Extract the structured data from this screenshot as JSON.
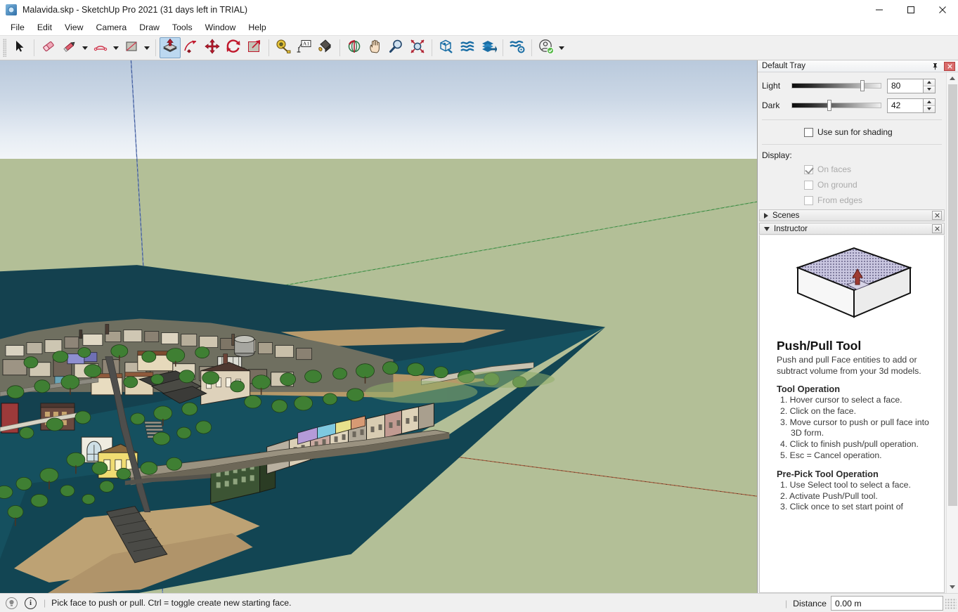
{
  "window": {
    "title": "Malavida.skp - SketchUp Pro 2021 (31 days left in TRIAL)",
    "app_icon": "sketchup-logo-icon",
    "minimize": "–",
    "maximize": "☐",
    "close": "✕"
  },
  "menu": {
    "items": [
      {
        "label": "File"
      },
      {
        "label": "Edit"
      },
      {
        "label": "View"
      },
      {
        "label": "Camera"
      },
      {
        "label": "Draw"
      },
      {
        "label": "Tools"
      },
      {
        "label": "Window"
      },
      {
        "label": "Help"
      }
    ]
  },
  "toolbar": {
    "groups": [
      {
        "tools": [
          {
            "name": "select-tool",
            "icon": "cursor-arrow-icon",
            "active": false,
            "dropdown": false
          }
        ]
      },
      {
        "tools": [
          {
            "name": "eraser-tool",
            "icon": "eraser-icon",
            "active": false,
            "dropdown": false
          },
          {
            "name": "line-tool",
            "icon": "pencil-icon",
            "active": false,
            "dropdown": true
          },
          {
            "name": "arc-tool",
            "icon": "arc-icon",
            "active": false,
            "dropdown": true
          },
          {
            "name": "rectangle-tool",
            "icon": "rectangle-icon",
            "active": false,
            "dropdown": true
          }
        ]
      },
      {
        "tools": [
          {
            "name": "push-pull-tool",
            "icon": "push-pull-icon",
            "active": true,
            "dropdown": false
          },
          {
            "name": "follow-me-tool",
            "icon": "follow-me-icon",
            "active": false,
            "dropdown": false
          },
          {
            "name": "move-tool",
            "icon": "move-arrows-icon",
            "active": false,
            "dropdown": false
          },
          {
            "name": "rotate-tool",
            "icon": "rotate-arrows-icon",
            "active": false,
            "dropdown": false
          },
          {
            "name": "scale-tool",
            "icon": "scale-icon",
            "active": false,
            "dropdown": false
          }
        ]
      },
      {
        "tools": [
          {
            "name": "tape-measure-tool",
            "icon": "tape-measure-icon",
            "active": false,
            "dropdown": false
          },
          {
            "name": "text-tool",
            "icon": "text-a1-icon",
            "active": false,
            "dropdown": false
          },
          {
            "name": "paint-bucket-tool",
            "icon": "paint-bucket-icon",
            "active": false,
            "dropdown": false
          }
        ]
      },
      {
        "tools": [
          {
            "name": "orbit-tool",
            "icon": "orbit-icon",
            "active": false,
            "dropdown": false
          },
          {
            "name": "pan-tool",
            "icon": "hand-pan-icon",
            "active": false,
            "dropdown": false
          },
          {
            "name": "zoom-tool",
            "icon": "magnifier-icon",
            "active": false,
            "dropdown": false
          },
          {
            "name": "zoom-extents-tool",
            "icon": "zoom-extents-icon",
            "active": false,
            "dropdown": false
          }
        ]
      },
      {
        "tools": [
          {
            "name": "3d-warehouse-tool",
            "icon": "warehouse-box-icon",
            "active": false,
            "dropdown": false
          },
          {
            "name": "extension-warehouse-tool",
            "icon": "extension-warehouse-icon",
            "active": false,
            "dropdown": false
          },
          {
            "name": "share-model-tool",
            "icon": "share-layers-icon",
            "active": false,
            "dropdown": false
          }
        ]
      },
      {
        "tools": [
          {
            "name": "extension-manager-tool",
            "icon": "extension-gear-icon",
            "active": false,
            "dropdown": false
          }
        ]
      },
      {
        "tools": [
          {
            "name": "account-tool",
            "icon": "user-account-icon",
            "active": false,
            "dropdown": true
          }
        ]
      }
    ]
  },
  "viewport": {
    "name": "3d-model-viewport",
    "model_description": "Aerial 3D city model of a riverside town with buildings, trees and a bridge",
    "colors": {
      "sky_top": "#b9c9dc",
      "sky_bottom": "#f2f5f8",
      "ground": "#b3bf97",
      "water": "#14414f",
      "sand": "#b99c6e",
      "axis_blue": "#3d5a9e",
      "axis_green": "#3a8a3f",
      "axis_red": "#a85a3a"
    }
  },
  "tray": {
    "title": "Default Tray",
    "pin_icon": "pin-icon",
    "close_icon": "close-icon",
    "shadow_settings": {
      "light": {
        "label": "Light",
        "value": "80",
        "slider_percent": 80
      },
      "dark": {
        "label": "Dark",
        "value": "42",
        "slider_percent": 42
      },
      "use_sun": {
        "label": "Use sun for shading",
        "checked": false
      },
      "display_label": "Display:",
      "display_options": [
        {
          "label": "On faces",
          "checked": true,
          "disabled": true
        },
        {
          "label": "On ground",
          "checked": false,
          "disabled": true
        },
        {
          "label": "From edges",
          "checked": false,
          "disabled": true
        }
      ]
    },
    "panels": [
      {
        "name": "scenes",
        "label": "Scenes",
        "expanded": false,
        "close_label": "✕"
      },
      {
        "name": "instructor",
        "label": "Instructor",
        "expanded": true,
        "close_label": "✕"
      }
    ]
  },
  "instructor": {
    "image_name": "push-pull-illustration",
    "title": "Push/Pull Tool",
    "description": "Push and pull Face entities to add or subtract volume from your 3d models.",
    "sections": [
      {
        "heading": "Tool Operation",
        "steps": [
          "1. Hover cursor to select a face.",
          "2. Click on the face.",
          "3. Move cursor to push or pull face into 3D form.",
          "4. Click to finish push/pull operation.",
          "5. Esc = Cancel operation."
        ]
      },
      {
        "heading": "Pre-Pick Tool Operation",
        "steps": [
          "1. Use Select tool to select a face.",
          "2. Activate Push/Pull tool.",
          "3. Click once to set start point of"
        ]
      }
    ]
  },
  "statusbar": {
    "help_icon": "bulb-help-icon",
    "info_icon": "info-circle-icon",
    "separator": "|",
    "message": "Pick face to push or pull.  Ctrl = toggle create new starting face.",
    "measure_separator": "|",
    "measure_label": "Distance",
    "measure_value": "0.00 m",
    "resize_grip": "resize-grip-icon"
  }
}
